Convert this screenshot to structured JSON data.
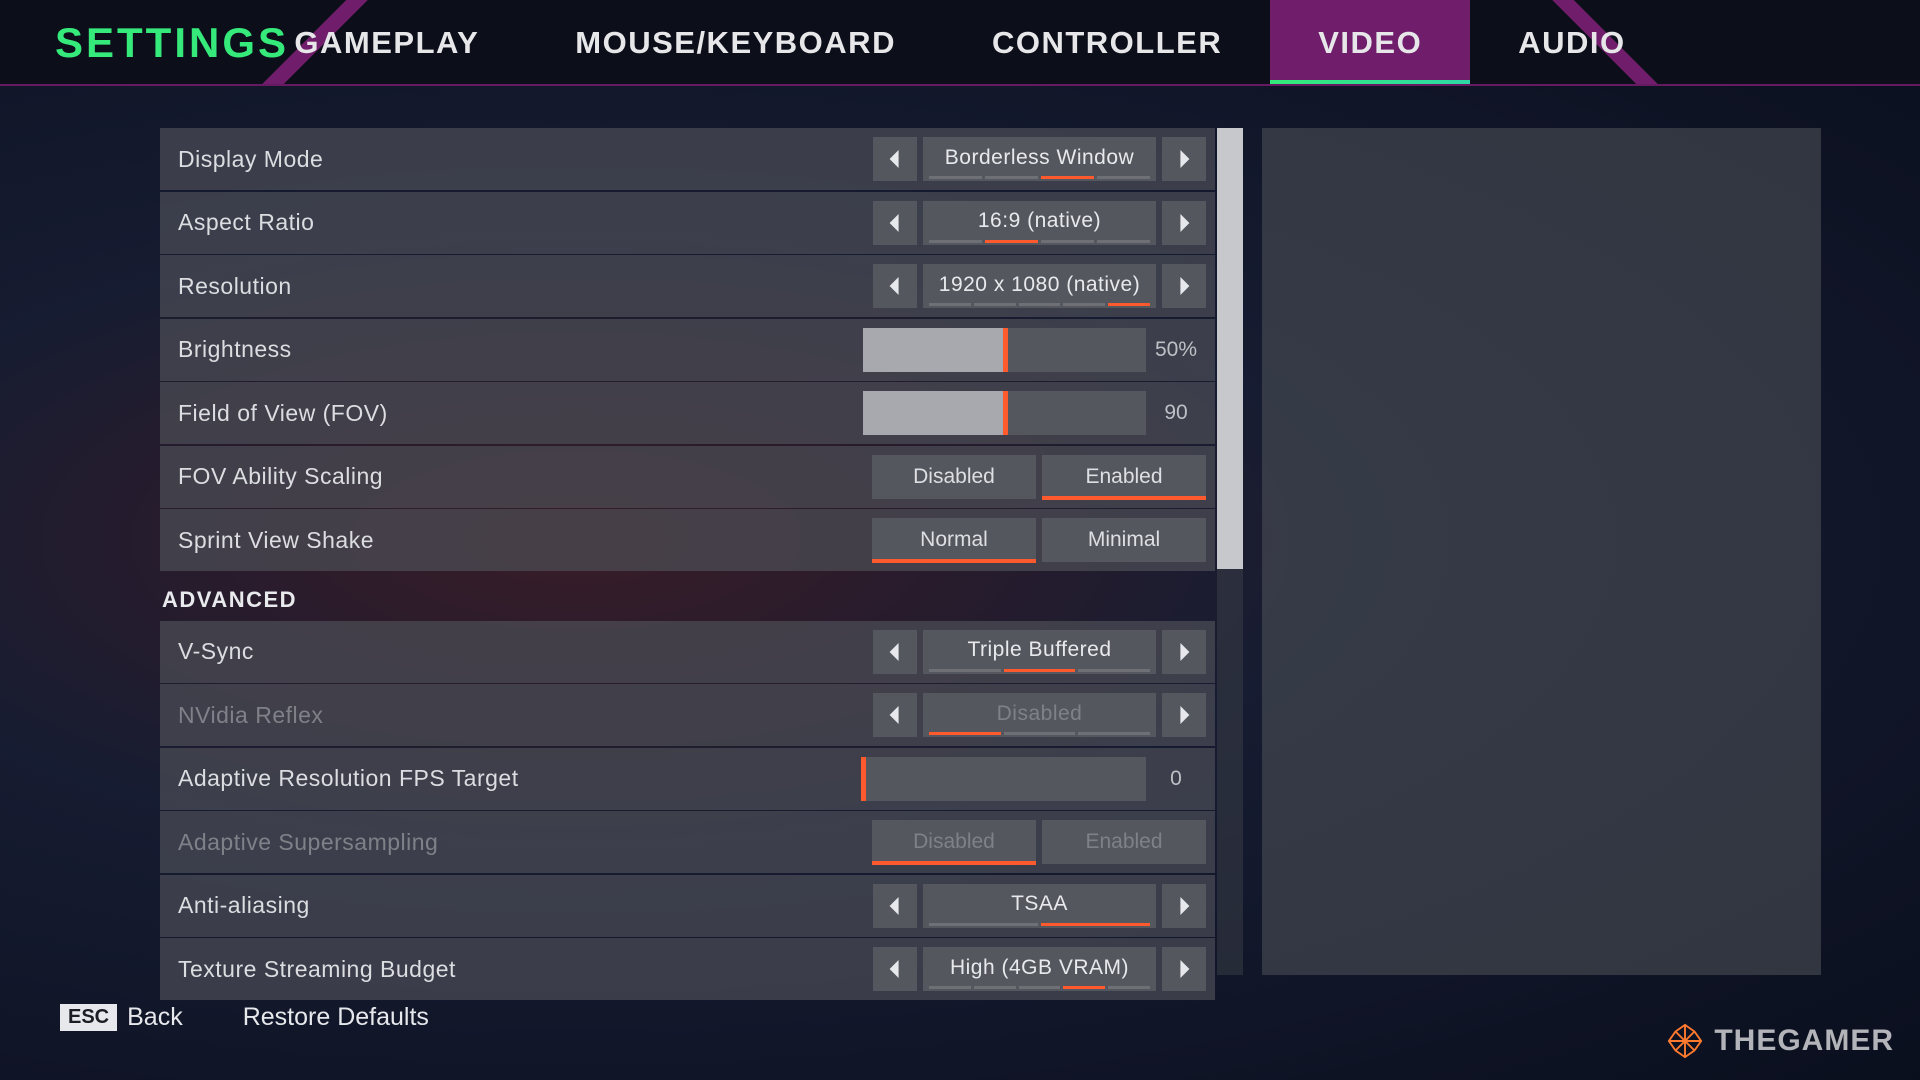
{
  "header": {
    "title": "SETTINGS",
    "tabs": [
      {
        "id": "gameplay",
        "label": "GAMEPLAY",
        "active": false
      },
      {
        "id": "mousekb",
        "label": "MOUSE/KEYBOARD",
        "active": false
      },
      {
        "id": "controller",
        "label": "CONTROLLER",
        "active": false
      },
      {
        "id": "video",
        "label": "VIDEO",
        "active": true
      },
      {
        "id": "audio",
        "label": "AUDIO",
        "active": false
      }
    ]
  },
  "sections": {
    "basic": [
      {
        "key": "display_mode",
        "label": "Display Mode",
        "type": "selector",
        "value": "Borderless Window",
        "ticks": 4,
        "tick_index": 2
      },
      {
        "key": "aspect_ratio",
        "label": "Aspect Ratio",
        "type": "selector",
        "value": "16:9 (native)",
        "ticks": 4,
        "tick_index": 1
      },
      {
        "key": "resolution",
        "label": "Resolution",
        "type": "selector",
        "value": "1920 x 1080 (native)",
        "ticks": 5,
        "tick_index": 4
      },
      {
        "key": "brightness",
        "label": "Brightness",
        "type": "slider",
        "value": "50%",
        "fill_pct": 50
      },
      {
        "key": "fov",
        "label": "Field of View (FOV)",
        "type": "slider",
        "value": "90",
        "fill_pct": 50
      },
      {
        "key": "fov_ability_scaling",
        "label": "FOV Ability Scaling",
        "type": "toggle",
        "options": [
          "Disabled",
          "Enabled"
        ],
        "active": 1
      },
      {
        "key": "sprint_shake",
        "label": "Sprint View Shake",
        "type": "toggle",
        "options": [
          "Normal",
          "Minimal"
        ],
        "active": 0
      }
    ],
    "advanced_header": "ADVANCED",
    "advanced": [
      {
        "key": "vsync",
        "label": "V-Sync",
        "type": "selector",
        "value": "Triple Buffered",
        "ticks": 3,
        "tick_index": 1
      },
      {
        "key": "nvidia_reflex",
        "label": "NVidia Reflex",
        "type": "selector",
        "value": "Disabled",
        "ticks": 3,
        "tick_index": 0,
        "disabled": true
      },
      {
        "key": "adaptive_res",
        "label": "Adaptive Resolution FPS Target",
        "type": "slider",
        "value": "0",
        "fill_pct": 0
      },
      {
        "key": "adaptive_ss",
        "label": "Adaptive Supersampling",
        "type": "toggle",
        "options": [
          "Disabled",
          "Enabled"
        ],
        "active": 0,
        "disabled": true
      },
      {
        "key": "anti_aliasing",
        "label": "Anti-aliasing",
        "type": "selector",
        "value": "TSAA",
        "ticks": 2,
        "tick_index": 1
      },
      {
        "key": "texture_stream",
        "label": "Texture Streaming Budget",
        "type": "selector",
        "value": "High (4GB VRAM)",
        "ticks": 5,
        "tick_index": 3
      }
    ]
  },
  "footer": {
    "esc_key_label": "ESC",
    "back_label": "Back",
    "restore_label": "Restore Defaults"
  },
  "watermark": "THEGAMER"
}
